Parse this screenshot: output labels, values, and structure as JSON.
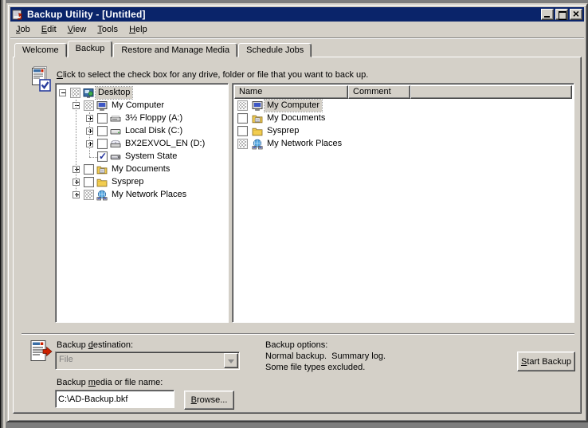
{
  "window": {
    "title": "Backup Utility - [Untitled]",
    "controls": {
      "minimize": "minimize",
      "maximize": "maximize",
      "close": "close"
    }
  },
  "colors": {
    "titlebar": "#0a246a",
    "window_bg": "#d4d0c8",
    "selection_bg": "#d4d0c8",
    "check_color": "#21309c",
    "desktop_bg": "#7d7d7d"
  },
  "menu": {
    "items": [
      {
        "label": "Job",
        "u": 0
      },
      {
        "label": "Edit",
        "u": 0
      },
      {
        "label": "View",
        "u": 0
      },
      {
        "label": "Tools",
        "u": 0
      },
      {
        "label": "Help",
        "u": 0
      }
    ]
  },
  "tabs": {
    "items": [
      {
        "label": "Welcome",
        "active": false
      },
      {
        "label": "Backup",
        "active": true
      },
      {
        "label": "Restore and Manage Media",
        "active": false
      },
      {
        "label": "Schedule Jobs",
        "active": false
      }
    ]
  },
  "instruction": {
    "label": "Click to select the check box for any drive, folder or file that you want to back up.",
    "u": 0,
    "icon": "page-check-icon"
  },
  "tree": {
    "items": [
      {
        "label": "Desktop",
        "depth": 0,
        "expand": "minus",
        "checkbox": "dimmed",
        "icon": "desktop-icon",
        "selected": true
      },
      {
        "label": "My Computer",
        "depth": 1,
        "expand": "minus",
        "checkbox": "dimmed",
        "icon": "my-computer-icon",
        "selected": false
      },
      {
        "label": "3½ Floppy (A:)",
        "depth": 2,
        "expand": "plus",
        "checkbox": "unchecked",
        "icon": "floppy-drive-icon",
        "selected": false
      },
      {
        "label": "Local Disk (C:)",
        "depth": 2,
        "expand": "plus",
        "checkbox": "unchecked",
        "icon": "hard-disk-icon",
        "selected": false
      },
      {
        "label": "BX2EXVOL_EN (D:)",
        "depth": 2,
        "expand": "plus",
        "checkbox": "unchecked",
        "icon": "cd-drive-icon",
        "selected": false
      },
      {
        "label": "System State",
        "depth": 2,
        "expand": "none",
        "checkbox": "checked",
        "icon": "system-state-icon",
        "selected": false
      },
      {
        "label": "My Documents",
        "depth": 1,
        "expand": "plus",
        "checkbox": "unchecked",
        "icon": "my-documents-icon",
        "selected": false
      },
      {
        "label": "Sysprep",
        "depth": 1,
        "expand": "plus",
        "checkbox": "unchecked",
        "icon": "folder-icon",
        "selected": false
      },
      {
        "label": "My Network Places",
        "depth": 1,
        "expand": "plus",
        "checkbox": "dimmed",
        "icon": "network-places-icon",
        "selected": false
      }
    ]
  },
  "list": {
    "columns": [
      "Name",
      "Comment",
      ""
    ],
    "rows": [
      {
        "name": "My Computer",
        "checkbox": "dimmed",
        "icon": "my-computer-icon",
        "comment": "",
        "selected": true
      },
      {
        "name": "My Documents",
        "checkbox": "unchecked",
        "icon": "my-documents-icon",
        "comment": "",
        "selected": false
      },
      {
        "name": "Sysprep",
        "checkbox": "unchecked",
        "icon": "folder-icon",
        "comment": "",
        "selected": false
      },
      {
        "name": "My Network Places",
        "checkbox": "dimmed",
        "icon": "network-places-icon",
        "comment": "",
        "selected": false
      }
    ]
  },
  "bottom": {
    "destination_label": {
      "label": "Backup destination:",
      "u": 7
    },
    "destination_value": "File",
    "destination_icon": "page-arrow-icon",
    "options_title": "Backup options:",
    "options_line1": "Normal backup.  Summary log.",
    "options_line2": "Some file types excluded.",
    "media_label": {
      "label": "Backup media or file name:",
      "u": 7
    },
    "media_value": "C:\\AD-Backup.bkf",
    "browse_button": {
      "label": "Browse...",
      "u": 0
    },
    "start_button": {
      "label": "Start Backup",
      "u": 0
    }
  }
}
